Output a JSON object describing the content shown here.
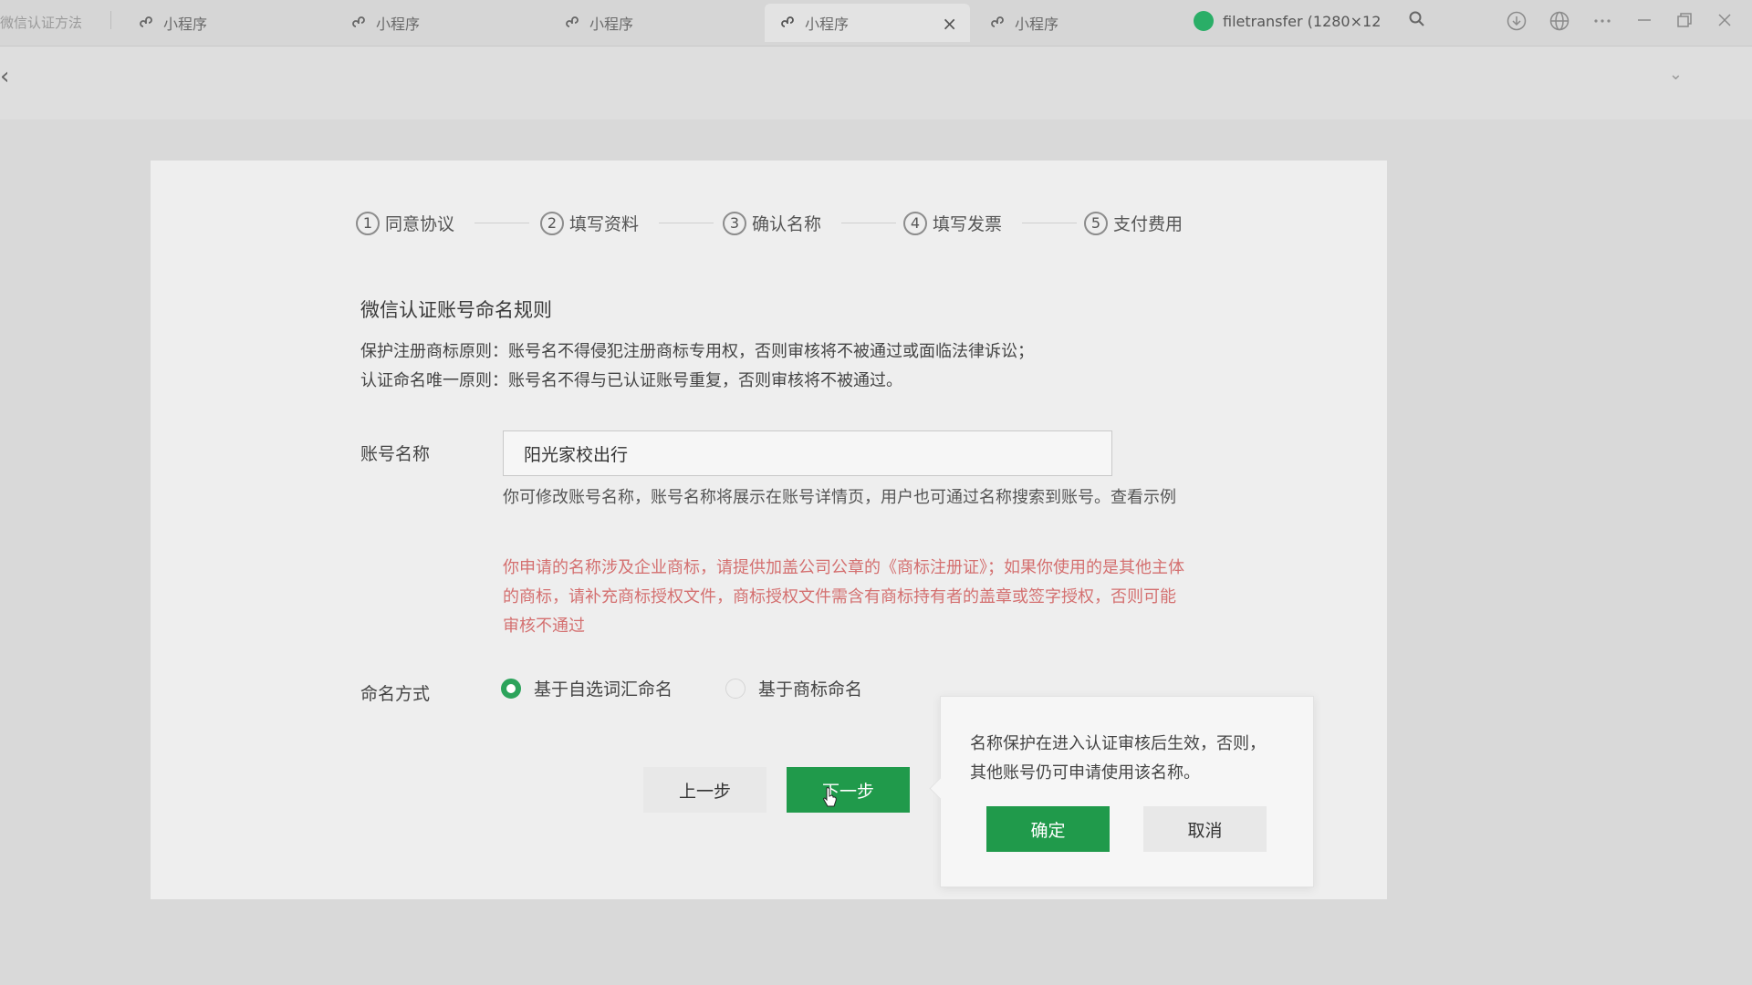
{
  "tabbar": {
    "first_tab_label": "微信认证方法",
    "tabs": [
      {
        "label": "小程序",
        "active": false
      },
      {
        "label": "小程序",
        "active": false
      },
      {
        "label": "小程序",
        "active": false
      },
      {
        "label": "小程序",
        "active": true
      },
      {
        "label": "小程序",
        "active": false
      }
    ],
    "filetransfer_label": "filetransfer (1280×12",
    "icons": [
      "search-icon",
      "download-icon",
      "globe-icon",
      "more-icon",
      "minimize-icon",
      "restore-icon",
      "close-icon"
    ],
    "close_glyph": "×"
  },
  "steps": [
    {
      "num": "1",
      "label": "同意协议"
    },
    {
      "num": "2",
      "label": "填写资料"
    },
    {
      "num": "3",
      "label": "确认名称"
    },
    {
      "num": "4",
      "label": "填写发票"
    },
    {
      "num": "5",
      "label": "支付费用"
    }
  ],
  "rules": {
    "title": "微信认证账号命名规则",
    "line1": "保护注册商标原则：账号名不得侵犯注册商标专用权，否则审核将不被通过或面临法律诉讼；",
    "line2": "认证命名唯一原则：账号名不得与已认证账号重复，否则审核将不被通过。"
  },
  "account_name": {
    "label": "账号名称",
    "value": "阳光家校出行",
    "hint": "你可修改账号名称，账号名称将展示在账号详情页，用户也可通过名称搜索到账号。查看示例",
    "warning": "你申请的名称涉及企业商标，请提供加盖公司公章的《商标注册证》；如果你使用的是其他主体的商标，请补充商标授权文件，商标授权文件需含有商标持有者的盖章或签字授权，否则可能审核不通过"
  },
  "naming_method": {
    "label": "命名方式",
    "options": [
      {
        "label": "基于自选词汇命名",
        "checked": true
      },
      {
        "label": "基于商标命名",
        "checked": false
      }
    ]
  },
  "buttons": {
    "prev": "上一步",
    "next": "下一步"
  },
  "popover": {
    "message": "名称保护在进入认证审核后生效，否则，其他账号仍可申请使用该名称。",
    "confirm": "确定",
    "cancel": "取消"
  },
  "colors": {
    "accent_green": "#209a4b",
    "warning_red": "#d47070"
  }
}
